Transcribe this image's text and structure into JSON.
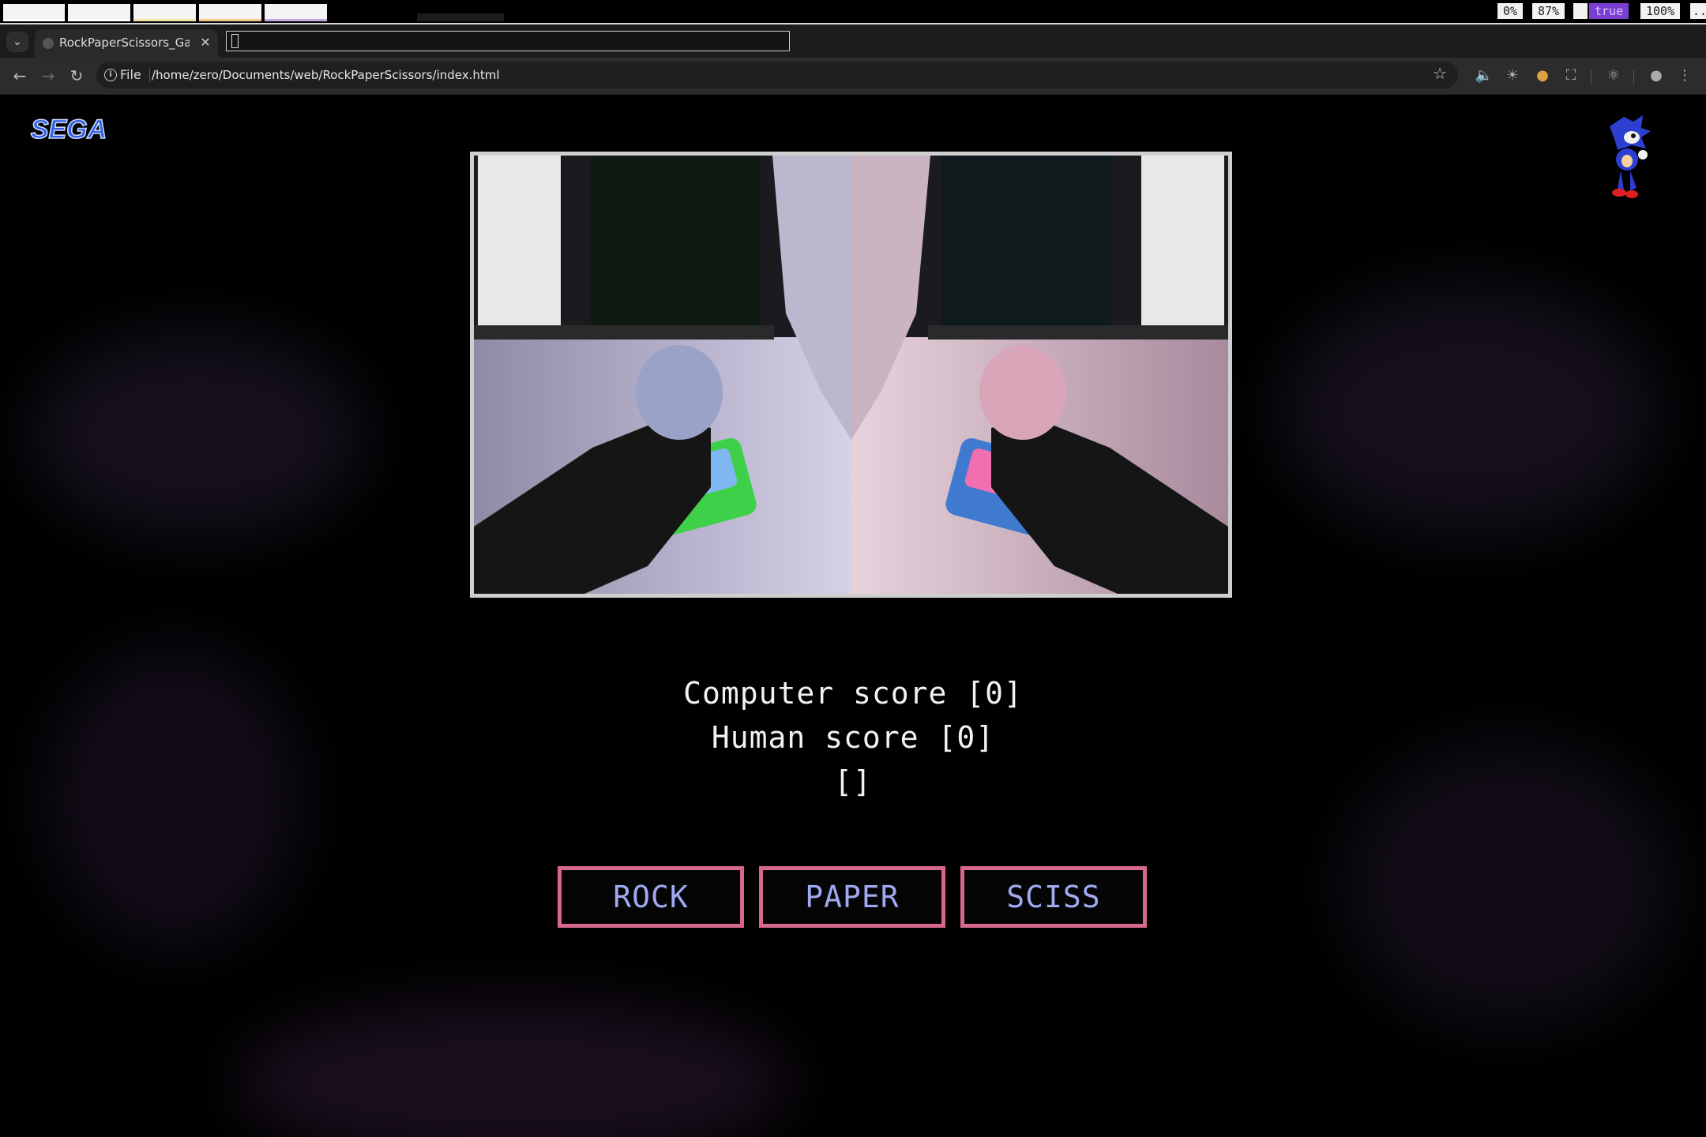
{
  "system_bar": {
    "stats": [
      "0%",
      "87%",
      "",
      "true",
      "100%",
      ".."
    ]
  },
  "browser": {
    "tab_title": "RockPaperScissors_Game",
    "scheme_label": "File",
    "url": "/home/zero/Documents/web/RockPaperScissors/index.html"
  },
  "page": {
    "logo_text": "SEGA",
    "computer_score_label": "Computer score [0]",
    "human_score_label": "Human score [0]",
    "result_label": "[]",
    "buttons": [
      "ROCK",
      "PAPER",
      "SCISS"
    ]
  },
  "colors": {
    "button_border": "#d8678d",
    "button_text": "#9fa8f0",
    "sega_blue": "#2f5fe0"
  }
}
